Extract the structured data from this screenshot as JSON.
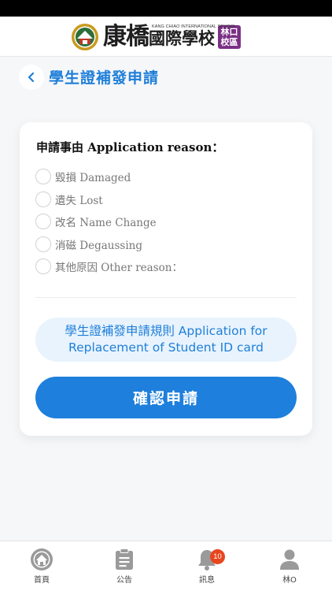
{
  "header": {
    "school_name_big": "康橋",
    "school_name_rest": "國際學校",
    "school_name_en": "KANG CHIAO INTERNATIONAL SCHOOL",
    "campus_line1": "林口",
    "campus_line2": "校區"
  },
  "page": {
    "title": "學生證補發申請"
  },
  "form": {
    "section_label": "申請事由 Application reason：",
    "reasons": [
      {
        "label": "毀損 Damaged"
      },
      {
        "label": "遺失 Lost"
      },
      {
        "label": "改名 Name Change"
      },
      {
        "label": "消磁 Degaussing"
      },
      {
        "label": "其他原因 Other reason："
      }
    ],
    "rules_button": "學生證補發申請規則 Application for Replacement of Student ID card",
    "confirm_button": "確認申請"
  },
  "tabbar": {
    "tabs": [
      {
        "label": "首頁",
        "icon": "home-emblem-icon"
      },
      {
        "label": "公告",
        "icon": "clipboard-icon"
      },
      {
        "label": "訊息",
        "icon": "bell-icon"
      },
      {
        "label": "林O",
        "icon": "person-icon"
      }
    ],
    "message_badge": "10"
  },
  "colors": {
    "accent": "#1e7fdc",
    "accent_light": "#e8f3fd",
    "badge": "#e8451f",
    "campus": "#7b2f85"
  }
}
